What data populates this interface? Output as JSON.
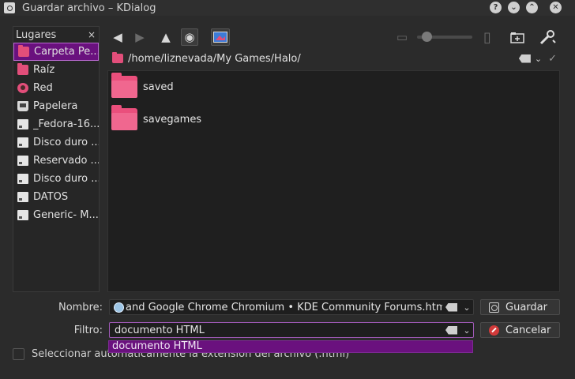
{
  "window": {
    "title": "Guardar archivo – KDialog"
  },
  "titlebar_buttons": [
    "?",
    "⌄",
    "⌃",
    "✕"
  ],
  "places": {
    "header": "Lugares",
    "close": "×",
    "items": [
      {
        "label": "Carpeta Pe...",
        "icon": "folder-icon"
      },
      {
        "label": "Raíz",
        "icon": "folder-icon"
      },
      {
        "label": "Red",
        "icon": "network-icon"
      },
      {
        "label": "Papelera",
        "icon": "trash-icon"
      },
      {
        "label": "_Fedora-16...",
        "icon": "drive-icon"
      },
      {
        "label": "Disco duro ...",
        "icon": "drive-icon"
      },
      {
        "label": "Reservado ...",
        "icon": "drive-icon"
      },
      {
        "label": "Disco duro ...",
        "icon": "drive-icon"
      },
      {
        "label": "DATOS",
        "icon": "drive-icon"
      },
      {
        "label": "Generic- M...",
        "icon": "drive-icon"
      }
    ]
  },
  "path": {
    "value": "/home/liznevada/My Games/Halo/"
  },
  "files": [
    {
      "name": "saved"
    },
    {
      "name": "savegames"
    }
  ],
  "form": {
    "name_label": "Nombre:",
    "name_value": "and Google Chrome Chromium • KDE Community Forums.html",
    "filter_label": "Filtro:",
    "filter_value": "documento HTML",
    "filter_options": [
      "documento HTML"
    ],
    "save_button": "Guardar",
    "cancel_button": "Cancelar",
    "auto_extension_label": "Seleccionar automáticamente la extensión del archivo (.html)"
  },
  "colors": {
    "accent": "#6a117e",
    "folder": "#ea4f7c"
  }
}
